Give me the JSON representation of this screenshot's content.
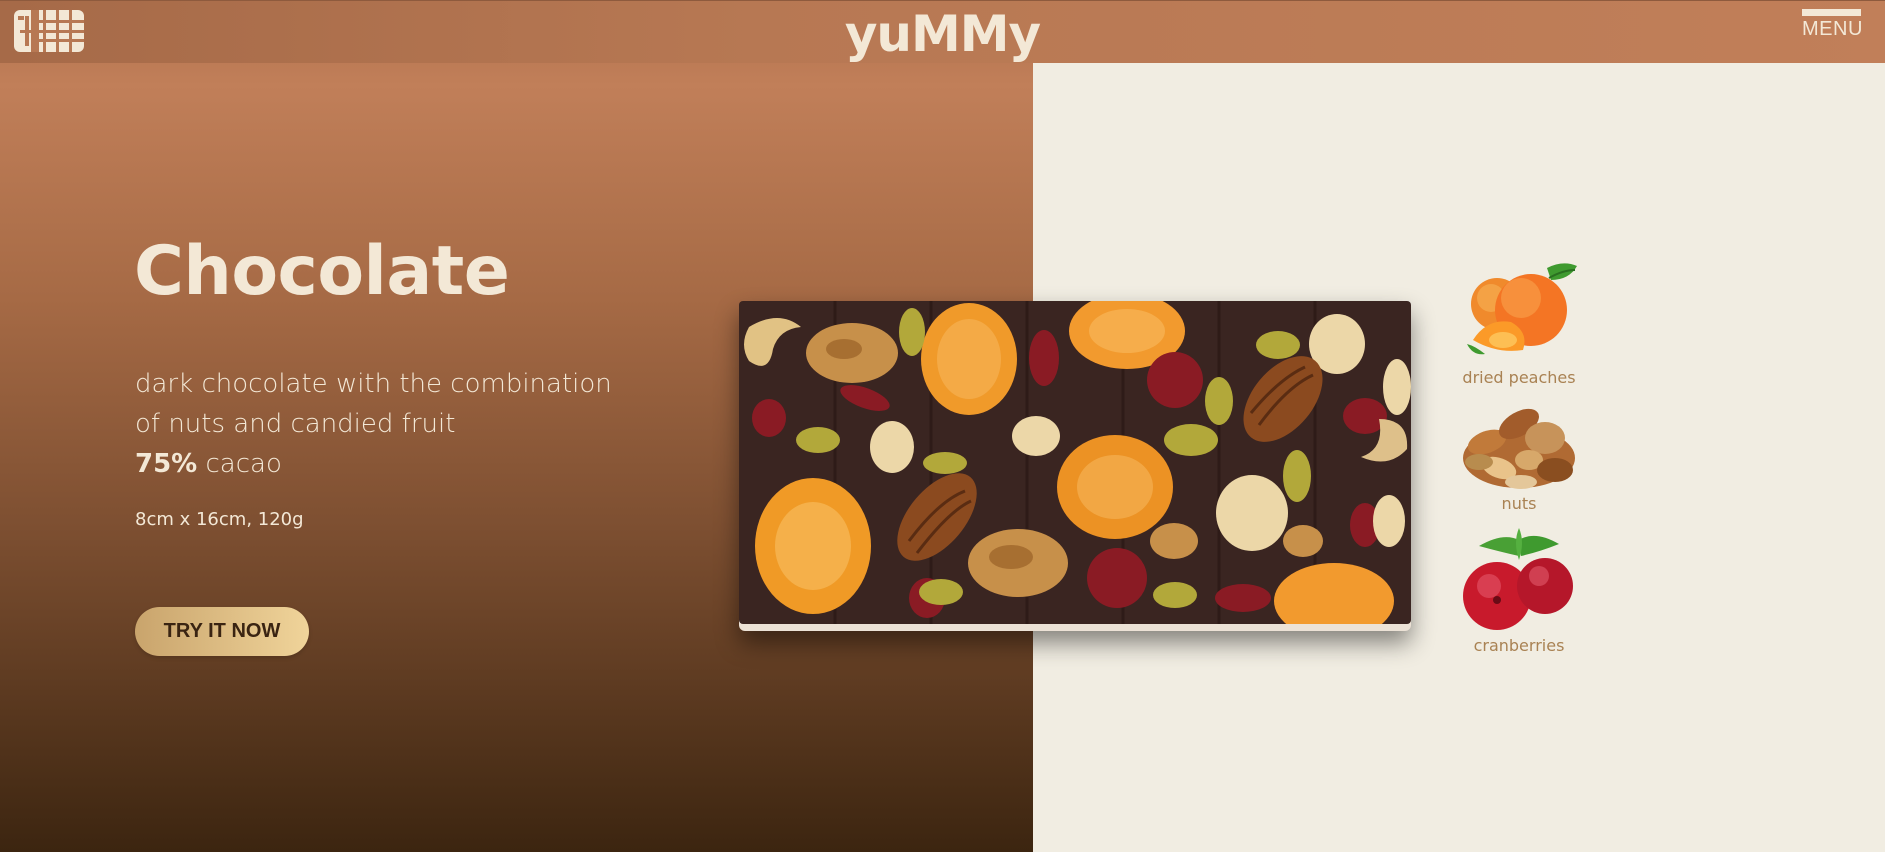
{
  "header": {
    "brand": "yuMMy",
    "menu_label": "MENU",
    "logo_icon": "chocolate-bar-logo-icon"
  },
  "product": {
    "title": "Chocolate",
    "description_line1": "dark chocolate with the combination",
    "description_line2": "of nuts and candied fruit",
    "cacao_percent": "75%",
    "cacao_label": " cacao",
    "dimensions": "8cm x 16cm, 120g",
    "cta_label": "TRY IT NOW",
    "image": "chocolate-bar-with-nuts-and-fruit"
  },
  "ingredients": [
    {
      "label": "dried peaches",
      "icon": "peach-icon"
    },
    {
      "label": "nuts",
      "icon": "nuts-icon"
    },
    {
      "label": "cranberries",
      "icon": "cranberry-icon"
    }
  ],
  "colors": {
    "header_bg": "#b77853",
    "cream": "#f3e8d6",
    "right_panel_bg": "#f1ede2",
    "label_gold": "#a98253",
    "chocolate": "#3a2521"
  }
}
